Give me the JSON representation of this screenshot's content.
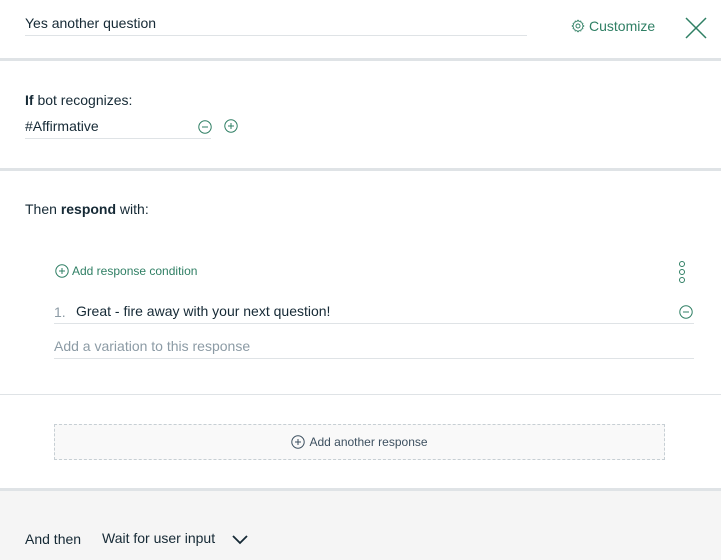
{
  "header": {
    "node_name": "Yes another question",
    "customize_label": "Customize"
  },
  "condition": {
    "if_prefix": "If",
    "if_suffix": " bot recognizes:",
    "value": "#Affirmative"
  },
  "response": {
    "then_prefix": "Then ",
    "then_bold": "respond",
    "then_suffix": " with:",
    "add_condition_label": "Add response condition",
    "items": [
      {
        "number": "1.",
        "text": "Great - fire away with your next question!"
      }
    ],
    "variation_placeholder": "Add a variation to this response",
    "add_another_label": "Add another response"
  },
  "footer": {
    "and_then_label": "And then",
    "next_step_value": "Wait for user input"
  },
  "colors": {
    "accent": "#2f7f64",
    "divider": "#dfe3e6",
    "footer_bg": "#f5f5f5"
  }
}
